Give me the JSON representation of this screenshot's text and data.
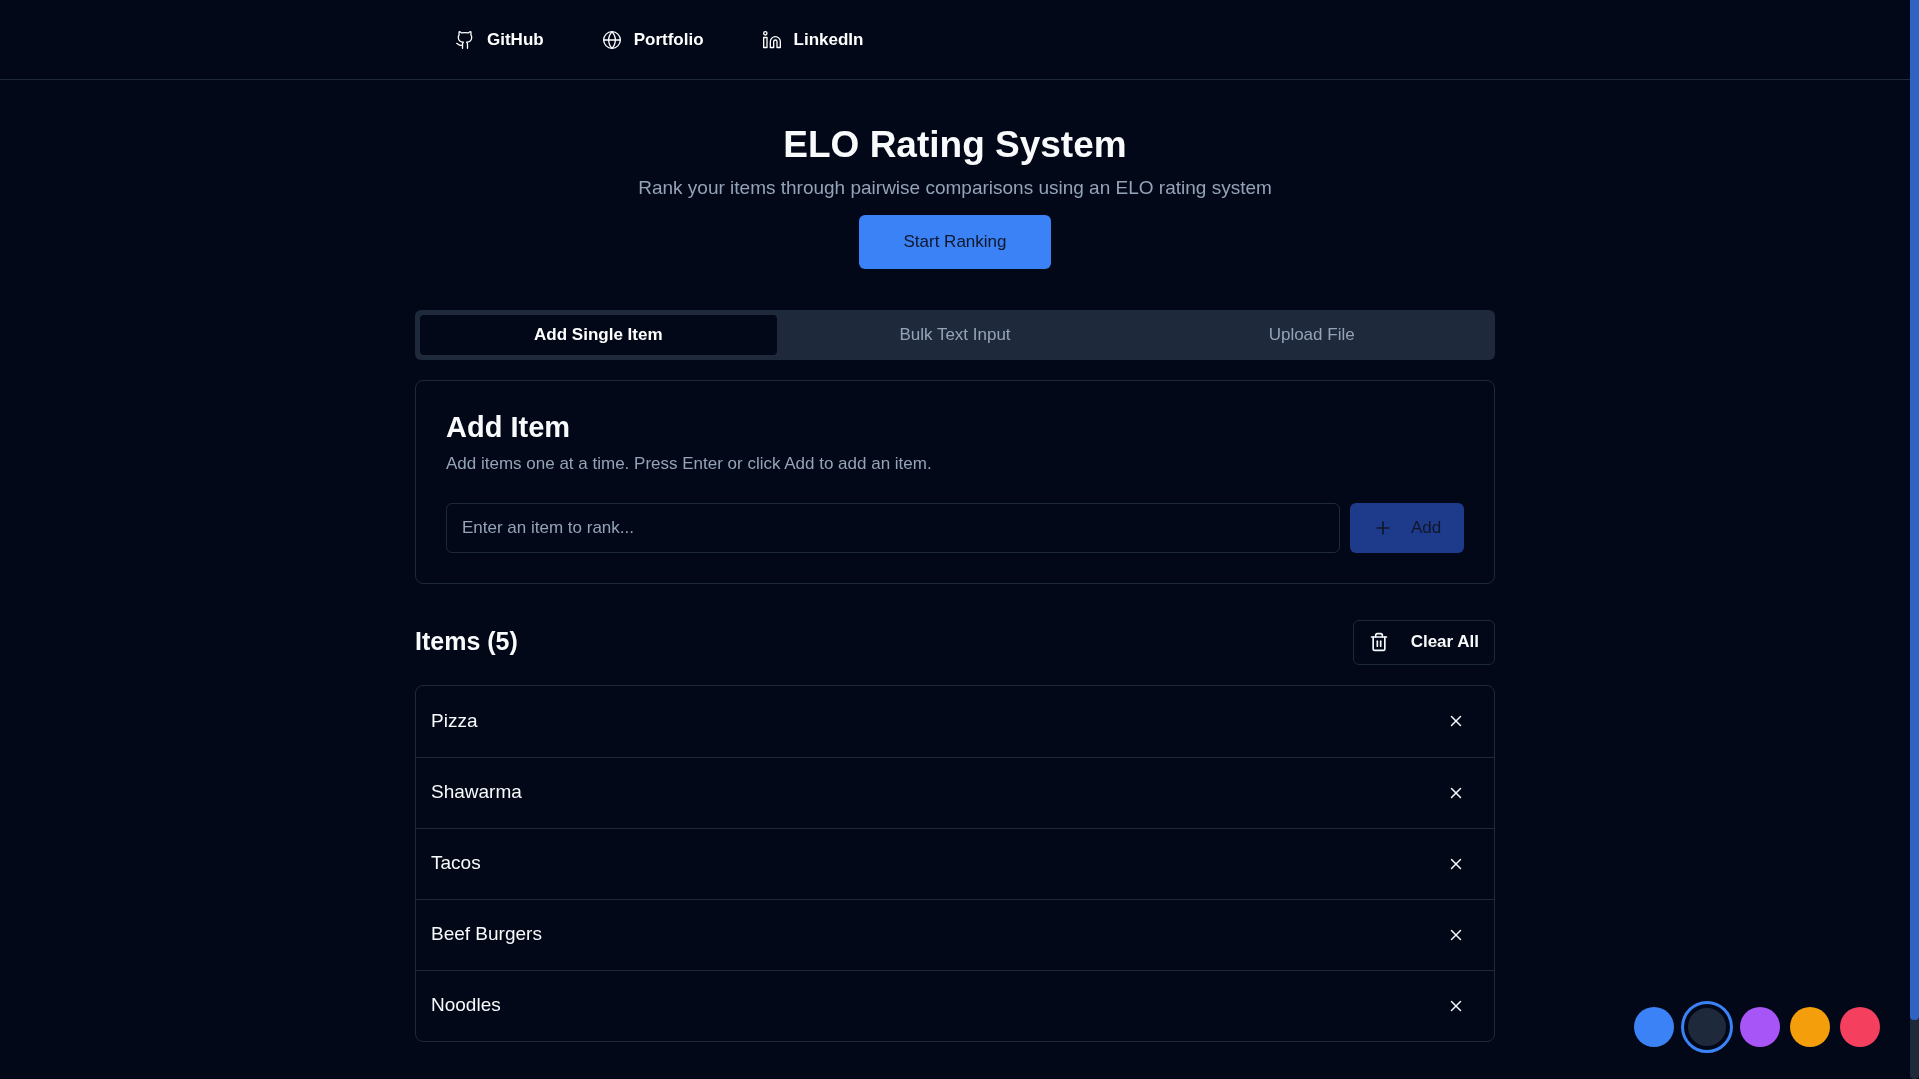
{
  "nav": [
    {
      "kind": "github",
      "label": "GitHub"
    },
    {
      "kind": "globe",
      "label": "Portfolio"
    },
    {
      "kind": "linkedin",
      "label": "LinkedIn"
    }
  ],
  "header": {
    "title": "ELO Rating System",
    "subtitle": "Rank your items through pairwise comparisons using an ELO rating system",
    "button": "Start Ranking"
  },
  "tabs": [
    {
      "label": "Add Single Item",
      "selected": true
    },
    {
      "label": "Bulk Text Input",
      "selected": false
    },
    {
      "label": "Upload File",
      "selected": false
    }
  ],
  "add_card": {
    "title": "Add Item",
    "description": "Add items one at a time. Press Enter or click Add to add an item.",
    "placeholder": "Enter an item to rank...",
    "button": "Add"
  },
  "items_header": {
    "title": "Items (5)",
    "clear_button": "Clear All"
  },
  "items": [
    {
      "name": "Pizza"
    },
    {
      "name": "Shawarma"
    },
    {
      "name": "Tacos"
    },
    {
      "name": "Beef Burgers"
    },
    {
      "name": "Noodles"
    }
  ],
  "themes": [
    {
      "color": "#3b82f6",
      "selected": false
    },
    {
      "color": "#1e293b",
      "selected": true
    },
    {
      "color": "#a855f7",
      "selected": false
    },
    {
      "color": "#f59e0b",
      "selected": false
    },
    {
      "color": "#f43f5e",
      "selected": false
    }
  ]
}
